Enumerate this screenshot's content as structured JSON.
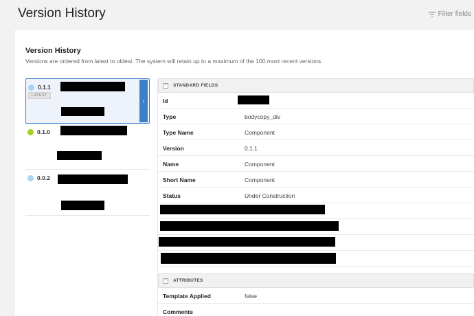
{
  "page": {
    "title": "Version History",
    "filter_label": "Filter fields"
  },
  "card": {
    "title": "Version History",
    "subtitle": "Versions are ordered from latest to oldest. The system will retain up to a maximum of the 100 most recent versions."
  },
  "versions": [
    {
      "label": "0.1.1",
      "badge": "LATEST",
      "dot_color": "#a8d4f2",
      "selected": true
    },
    {
      "label": "0.1.0",
      "dot_color": "#a4cf2a",
      "selected": false
    },
    {
      "label": "0.0.2",
      "dot_color": "#a8d4f2",
      "selected": false
    }
  ],
  "standard_fields": {
    "title": "STANDARD FIELDS",
    "rows": [
      {
        "key": "Id",
        "value": ""
      },
      {
        "key": "Type",
        "value": "bodycopy_div"
      },
      {
        "key": "Type Name",
        "value": "Component"
      },
      {
        "key": "Version",
        "value": "0.1.1"
      },
      {
        "key": "Name",
        "value": "Component"
      },
      {
        "key": "Short Name",
        "value": "Component"
      },
      {
        "key": "Status",
        "value": "Under Construction"
      }
    ]
  },
  "attributes": {
    "title": "ATTRIBUTES",
    "rows": [
      {
        "key": "Template Applied",
        "value": "false"
      },
      {
        "key": "Comments",
        "value": ""
      }
    ]
  },
  "colors": {
    "accent": "#3a7fc8",
    "selected_bg": "#eef2fb",
    "page_bg": "#f2f2f2"
  }
}
